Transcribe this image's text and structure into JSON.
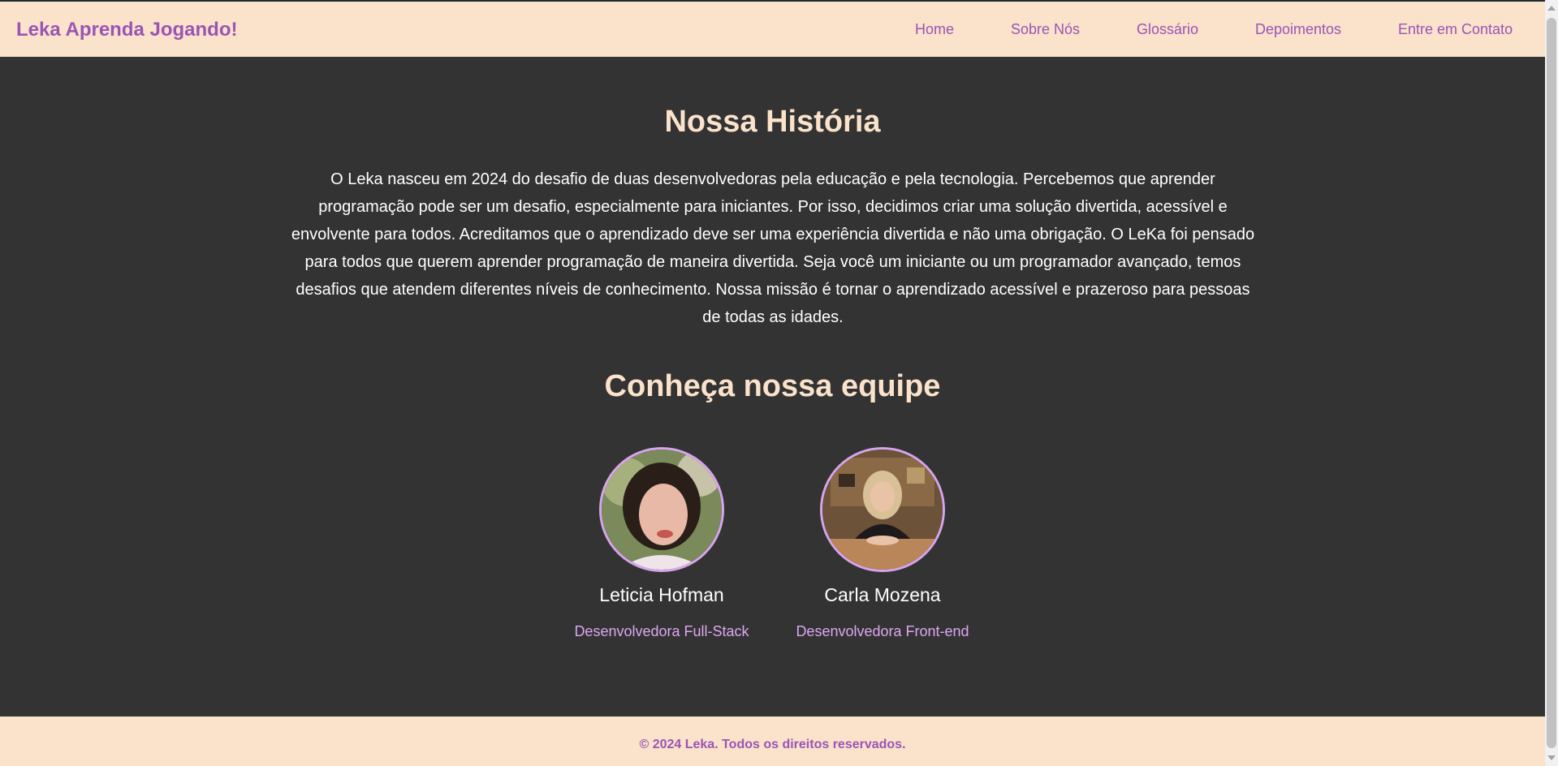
{
  "header": {
    "logo": "Leka Aprenda Jogando!",
    "nav": [
      "Home",
      "Sobre Nós",
      "Glossário",
      "Depoimentos",
      "Entre em Contato"
    ]
  },
  "story": {
    "title": "Nossa História",
    "text": "O Leka nasceu em 2024 do desafio de duas desenvolvedoras pela educação e pela tecnologia. Percebemos que aprender programação pode ser um desafio, especialmente para iniciantes. Por isso, decidimos criar uma solução divertida, acessível e envolvente para todos. Acreditamos que o aprendizado deve ser uma experiência divertida e não uma obrigação. O LeKa foi pensado para todos que querem aprender programação de maneira divertida. Seja você um iniciante ou um programador avançado, temos desafios que atendem diferentes níveis de conhecimento. Nossa missão é tornar o aprendizado acessível e prazeroso para pessoas de todas as idades."
  },
  "team": {
    "title": "Conheça nossa equipe",
    "members": [
      {
        "name": "Leticia Hofman",
        "role": "Desenvolvedora Full-Stack"
      },
      {
        "name": "Carla Mozena",
        "role": "Desenvolvedora Front-end"
      }
    ]
  },
  "footer": {
    "copyright": "© 2024 Leka. Todos os direitos reservados."
  },
  "colors": {
    "header_bg": "#fae2cb",
    "main_bg": "#333333",
    "accent_purple": "#9a55b4",
    "role_lilac": "#dca7f2",
    "title_peach": "#fae2cb"
  }
}
